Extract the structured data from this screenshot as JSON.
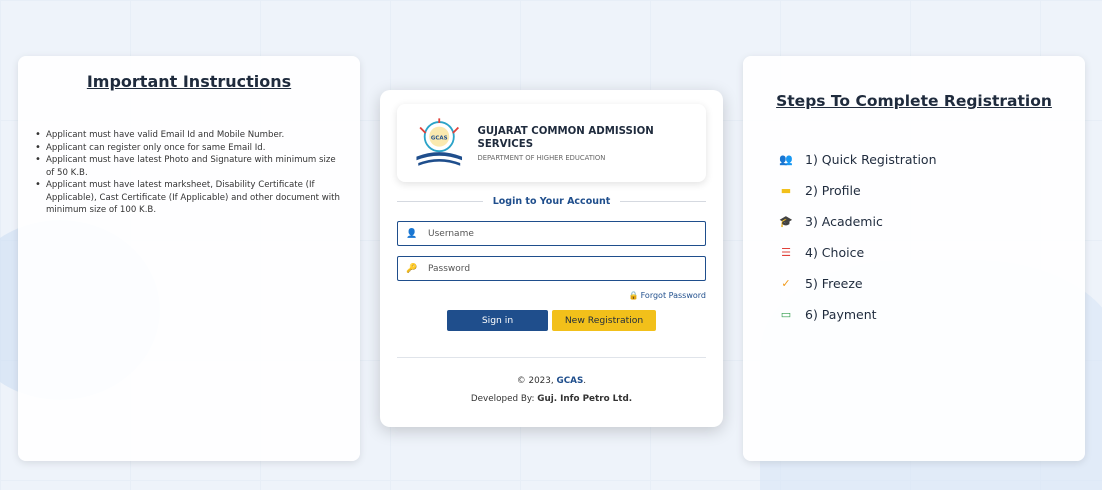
{
  "instructions": {
    "title": "Important Instructions",
    "items": [
      "Applicant must have valid Email Id and Mobile Number.",
      "Applicant can register only once for same Email Id.",
      "Applicant must have latest Photo and Signature with minimum size of 50 K.B.",
      "Applicant must have latest marksheet, Disability Certificate (If Applicable), Cast Certificate (If Applicable) and other document with minimum size of 100 K.B."
    ]
  },
  "login": {
    "brand_title": "GUJARAT COMMON ADMISSION SERVICES",
    "brand_subtitle": "DEPARTMENT OF HIGHER EDUCATION",
    "logo_text": "GCAS",
    "section_label": "Login to Your Account",
    "username_placeholder": "Username",
    "password_placeholder": "Password",
    "forgot_label": "Forgot Password",
    "signin_label": "Sign in",
    "register_label": "New Registration",
    "footer_copyright": "© 2023, ",
    "footer_brand": "GCAS",
    "footer_suffix": ".",
    "footer_developer_prefix": "Developed By: ",
    "footer_developer": "Guj. Info Petro Ltd."
  },
  "steps": {
    "title": "Steps To Complete Registration",
    "items": [
      {
        "label": "1) Quick Registration",
        "icon": "user-plus-icon",
        "color": "#1f4e8c"
      },
      {
        "label": "2) Profile",
        "icon": "id-card-icon",
        "color": "#f2c01a"
      },
      {
        "label": "3) Academic",
        "icon": "graduation-cap-icon",
        "color": "#2aa3c8"
      },
      {
        "label": "4) Choice",
        "icon": "list-icon",
        "color": "#e0413a"
      },
      {
        "label": "5) Freeze",
        "icon": "check-icon",
        "color": "#f29a1a"
      },
      {
        "label": "6) Payment",
        "icon": "money-icon",
        "color": "#2e9c4a"
      }
    ]
  },
  "colors": {
    "primary": "#1f4e8c",
    "accent": "#f2c01a",
    "background": "#eef3fa"
  }
}
